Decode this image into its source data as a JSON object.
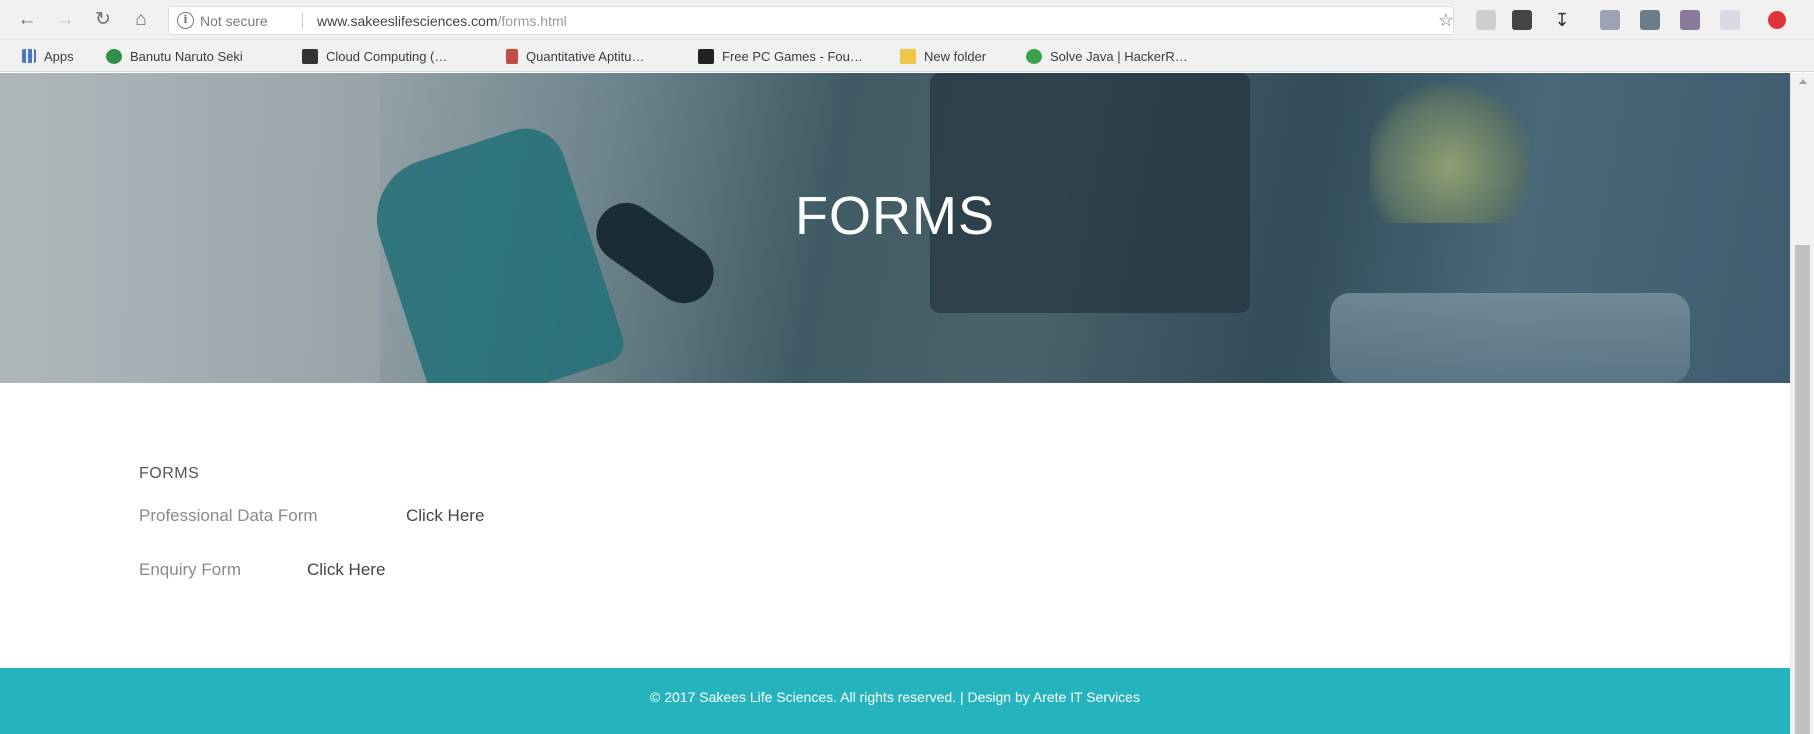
{
  "browser": {
    "not_secure_label": "Not secure",
    "url_host": "www.sakeeslifesciences.com",
    "url_path": "/forms.html",
    "toolbar_icons": [
      "star-icon",
      "reader-icon",
      "extension-icon",
      "download-icon",
      "extension-icon",
      "extension-icon",
      "extension-icon",
      "extension-icon",
      "opera-icon"
    ],
    "bookmarks": [
      {
        "icon": "apps-icon",
        "label": "Apps"
      },
      {
        "icon": "heart-icon",
        "label": "Banutu Naruto Seki"
      },
      {
        "icon": "cloud-icon",
        "label": "Cloud Computing (…"
      },
      {
        "icon": "chart-icon",
        "label": "Quantitative Aptitu…"
      },
      {
        "icon": "gamepad-icon",
        "label": "Free PC Games - Fou…"
      },
      {
        "icon": "folder-icon",
        "label": "New folder"
      },
      {
        "icon": "globe-icon",
        "label": "Solve Java | HackerR…"
      }
    ]
  },
  "hero": {
    "title": "FORMS"
  },
  "content": {
    "heading": "FORMS",
    "rows": [
      {
        "label": "Professional Data Form",
        "link": "Click Here"
      },
      {
        "label": "Enquiry Form",
        "link": "Click Here"
      }
    ]
  },
  "footer": {
    "text": "© 2017 Sakees Life Sciences. All rights reserved. | Design by Arete IT Services"
  },
  "colors": {
    "footer_bg": "#25b4bd",
    "hero_overlay": "#3d5a68"
  }
}
